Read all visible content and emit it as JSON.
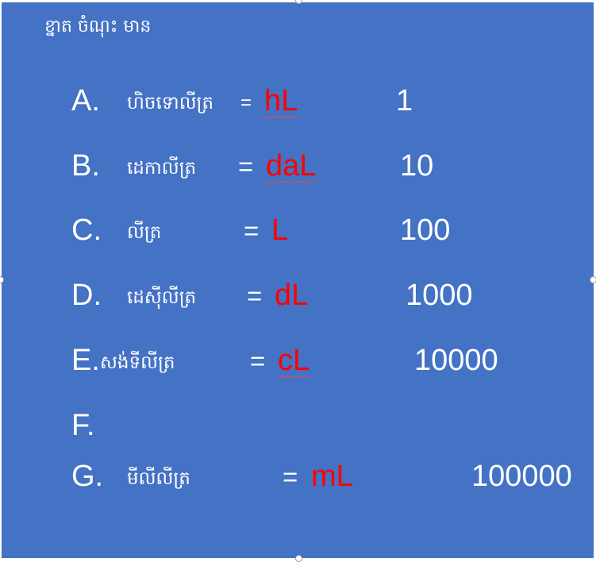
{
  "heading": "ខ្នាត ចំណុះ មាន",
  "rows": [
    {
      "letter": "A.",
      "name": "ហិចទោលីត្រ",
      "eq": "=",
      "unit": "hL",
      "value": "1"
    },
    {
      "letter": "B.",
      "name": "ដេកាលីត្រ",
      "eq": "=",
      "unit": "daL",
      "value": "10"
    },
    {
      "letter": "C.",
      "name": "លីត្រ",
      "eq": "=",
      "unit": "L",
      "value": "100"
    },
    {
      "letter": "D.",
      "name": "ដេស៊ីលីត្រ",
      "eq": "=",
      "unit": "dL",
      "value": "1000"
    },
    {
      "letter": "E.",
      "name": "សង់ទីលីត្រ",
      "eq": "=",
      "unit": "cL",
      "value": "10000"
    },
    {
      "letter": "F.",
      "name": "",
      "eq": "",
      "unit": "",
      "value": ""
    },
    {
      "letter": "G.",
      "name": "មីលីលីត្រ",
      "eq": "=",
      "unit": "mL",
      "value": "100000"
    }
  ],
  "colors": {
    "background": "#4472c4",
    "text": "#ffffff",
    "unit": "#ff0000"
  }
}
